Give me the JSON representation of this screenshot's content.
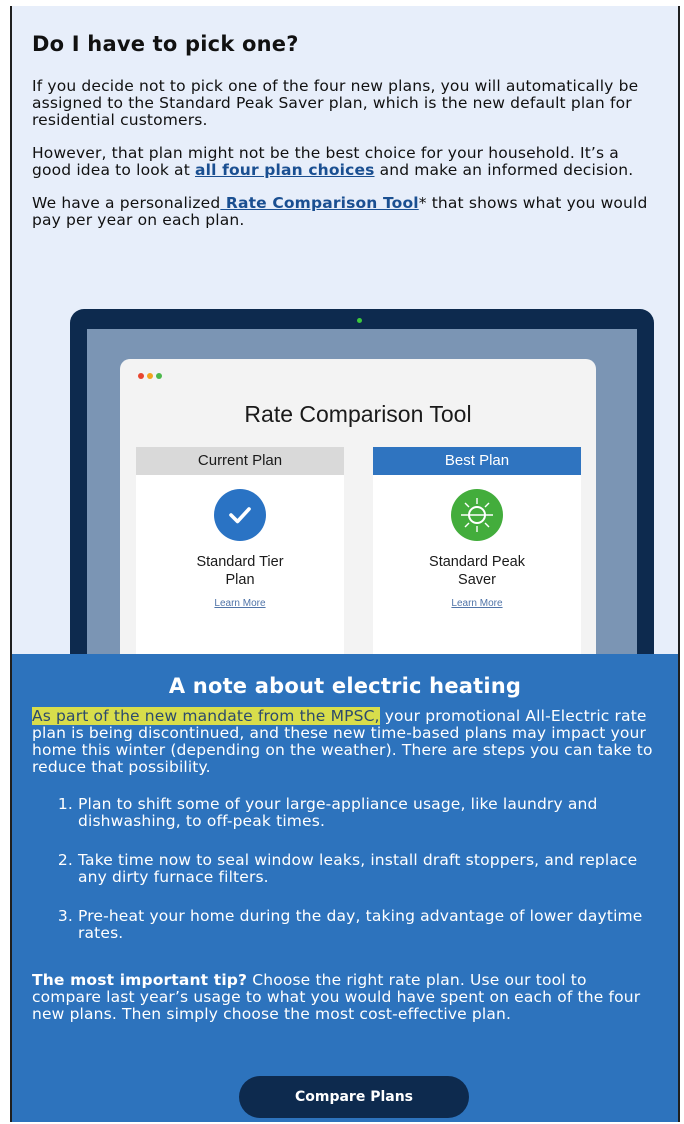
{
  "intro": {
    "heading": "Do I have to pick one?",
    "para1": "If you decide not to pick one of the four new plans, you will automatically be assigned to the Standard Peak Saver plan, which is the new default plan for residential customers.",
    "para2_before": "However, that plan might not be the best choice for your household. It’s a good idea to look at ",
    "para2_link": "all four plan choices",
    "para2_after": " and make an informed decision.",
    "para3_before": "We have a personalized",
    "para3_link": " Rate Comparison Tool",
    "para3_after": "* that shows what you would pay per year on each plan."
  },
  "illustration": {
    "window_title": "Rate Comparison Tool",
    "dot_colors": [
      "#e8452f",
      "#f2a41d",
      "#4cb84c"
    ],
    "current": {
      "header": "Current Plan",
      "icon": "checkmark-icon",
      "name_line1": "Standard Tier",
      "name_line2": "Plan",
      "link": "Learn More"
    },
    "best": {
      "header": "Best Plan",
      "icon": "sun-snowflake-icon",
      "name_line1": "Standard Peak",
      "name_line2": "Saver",
      "link": "Learn More"
    }
  },
  "note": {
    "heading": "A note about electric heating",
    "para_highlight": "As part of the new mandate from the MPSC,",
    "para_rest": " your promotional All-Electric rate plan is being discontinued, and these new time-based plans may impact your home this winter (depending on the weather). There are steps you can take to reduce that possibility.",
    "steps": [
      "Plan to shift some of your large-appliance usage, like laundry and dishwashing, to off-peak times.",
      "Take time now to seal window leaks, install draft stoppers, and replace any dirty furnace filters.",
      "Pre-heat your home during the day, taking advantage of lower daytime rates."
    ],
    "tip_bold": "The most important tip?",
    "tip_rest": " Choose the right rate plan. Use our tool to compare last year’s usage to what you would have spent on each of the four new plans. Then simply choose the most cost-effective plan.",
    "button": "Compare Plans"
  },
  "colors": {
    "accent": "#2d73bd",
    "dark": "#0d2a4e",
    "highlight": "#d8dd4b",
    "best_plan": "#43ad3c"
  }
}
